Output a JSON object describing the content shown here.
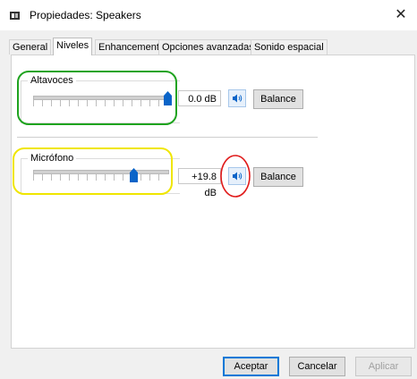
{
  "window": {
    "title": "Propiedades: Speakers",
    "close_glyph": "✕"
  },
  "tabs": [
    {
      "label": "General",
      "active": false
    },
    {
      "label": "Niveles",
      "active": true
    },
    {
      "label": "Enhancements",
      "active": false
    },
    {
      "label": "Opciones avanzadas",
      "active": false
    },
    {
      "label": "Sonido espacial",
      "active": false
    }
  ],
  "levels": [
    {
      "label": "Altavoces",
      "value": "0.0 dB",
      "level": 1.0,
      "mute_icon": "speaker-icon",
      "balance_label": "Balance"
    },
    {
      "label": "Micrófono",
      "value": "+19.8 dB",
      "level": 0.75,
      "mute_icon": "speaker-icon",
      "balance_label": "Balance"
    }
  ],
  "annotations": [
    {
      "shape": "rounded-rectangle",
      "color": "#1fa31f"
    },
    {
      "shape": "rounded-rectangle",
      "color": "#f0e600"
    },
    {
      "shape": "ellipse",
      "color": "#e01a1a"
    }
  ],
  "footer": {
    "ok_label": "Aceptar",
    "cancel_label": "Cancelar",
    "apply_label": "Aplicar",
    "apply_disabled": true
  },
  "colors": {
    "accent": "#0078d7",
    "thumb": "#0a64c8"
  }
}
